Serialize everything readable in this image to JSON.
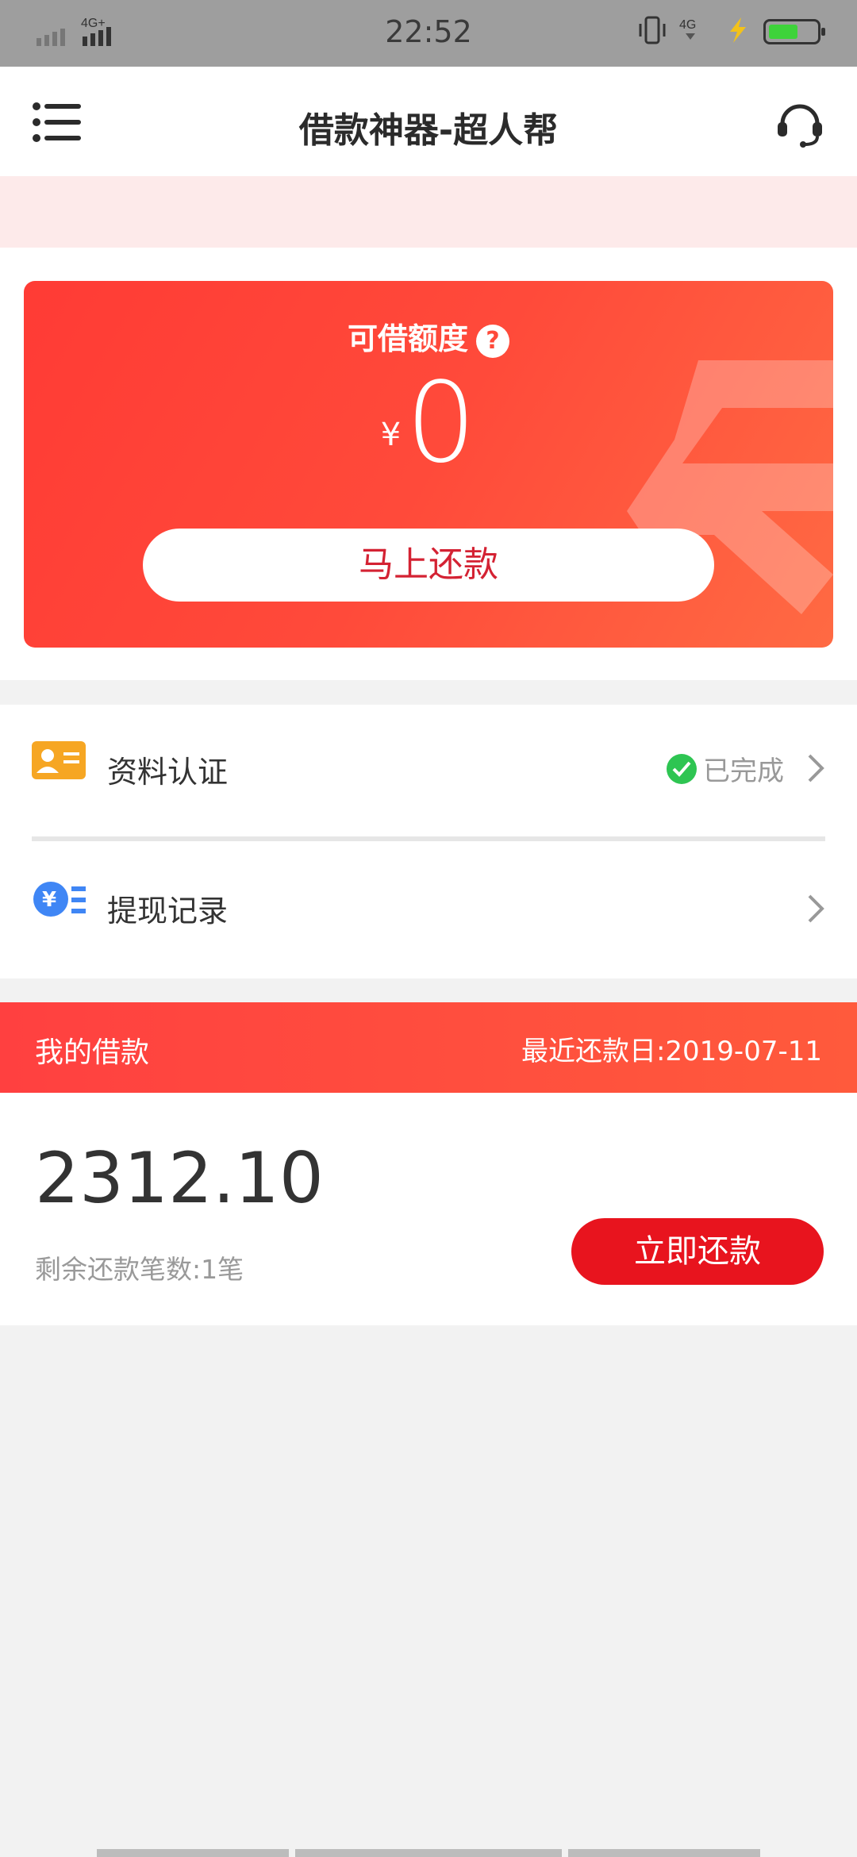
{
  "status_bar": {
    "time": "22:52",
    "network_left": "4G+",
    "network_right": "4G"
  },
  "header": {
    "title": "借款神器-超人帮",
    "menu_icon": "menu-icon",
    "support_icon": "headset-icon"
  },
  "credit_card": {
    "label": "可借额度",
    "help_icon": "?",
    "currency_symbol": "¥",
    "amount": "0",
    "button_label": "马上还款"
  },
  "list": {
    "items": [
      {
        "label": "资料认证",
        "status": "已完成",
        "icon": "id-card-icon"
      },
      {
        "label": "提现记录",
        "status": "",
        "icon": "yen-coin-icon"
      }
    ]
  },
  "my_loan": {
    "title": "我的借款",
    "recent_due_date": "最近还款日:2019-07-11",
    "total": "2312.10",
    "remaining": "剩余还款笔数:1笔",
    "button_label": "立即还款"
  },
  "colors": {
    "accent_red": "#ff4a3a",
    "button_red": "#e8141e",
    "success_green": "#2ec552"
  }
}
